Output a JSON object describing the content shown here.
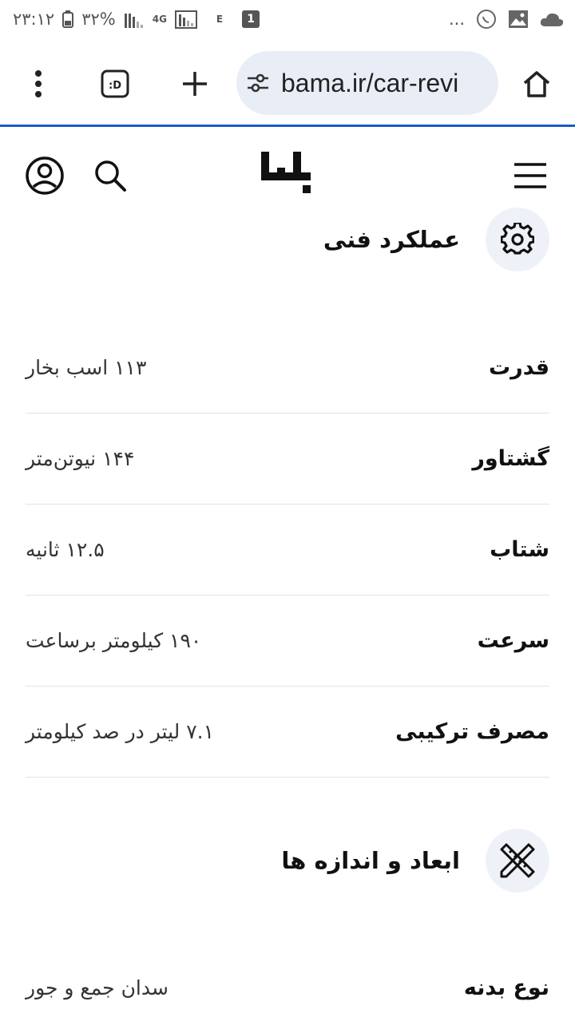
{
  "status_bar": {
    "time": "۲۳:۱۲",
    "battery": "۳۲%",
    "network": "4G",
    "e_indicator": "E",
    "sim_badge": "1",
    "more": "..."
  },
  "browser": {
    "url": "bama.ir/car-revi"
  },
  "sections": [
    {
      "title": "عملکرد فنی",
      "rows": [
        {
          "label": "قدرت",
          "value": "۱۱۳ اسب بخار"
        },
        {
          "label": "گشتاور",
          "value": "۱۴۴ نیوتن‌متر"
        },
        {
          "label": "شتاب",
          "value": "۱۲.۵ ثانیه"
        },
        {
          "label": "سرعت",
          "value": "۱۹۰ کیلومتر برساعت"
        },
        {
          "label": "مصرف ترکیبی",
          "value": "۷.۱ لیتر در صد کیلومتر"
        }
      ]
    },
    {
      "title": "ابعاد و اندازه ها",
      "rows": [
        {
          "label": "نوع بدنه",
          "value": "سدان جمع و جور"
        }
      ]
    }
  ]
}
